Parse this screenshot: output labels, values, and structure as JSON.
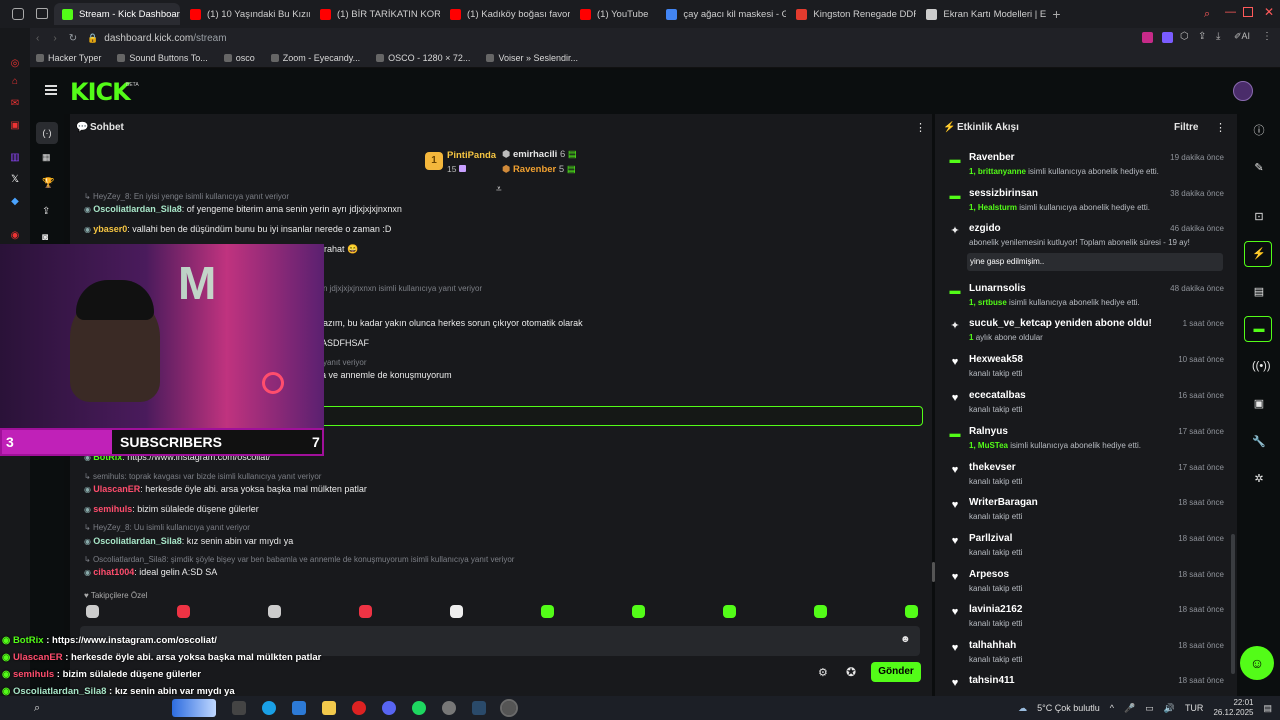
{
  "browser": {
    "tabs": [
      {
        "label": "Stream - Kick Dashboard",
        "color": "#53fc18",
        "active": true
      },
      {
        "label": "(1) 10 Yaşındaki Bu Kızın Ç",
        "color": "#ff0000"
      },
      {
        "label": "(1) BİR TARİKATIN KORKU",
        "color": "#ff0000"
      },
      {
        "label": "(1) Kadıköy boğası favori!",
        "color": "#ff0000"
      },
      {
        "label": "(1) YouTube",
        "color": "#ff0000"
      },
      {
        "label": "çay ağacı kil maskesi - Go",
        "color": "#4285f4"
      },
      {
        "label": "Kingston Renegade DDR5",
        "color": "#e33b2e"
      },
      {
        "label": "Ekran Kartı Modelleri | En",
        "color": "#cccccc"
      }
    ],
    "url_host": "dashboard.kick.com",
    "url_path": "/stream",
    "bookmarks": [
      "Hacker Typer",
      "Sound Buttons To...",
      "osco",
      "Zoom - Eyecandy...",
      "OSCO - 1280 × 72...",
      "Voiser » Seslendir..."
    ]
  },
  "kick": {
    "logo": "KICK",
    "beta": "BETA"
  },
  "chat": {
    "title": "Sohbet",
    "leaderboard": [
      {
        "rank": "1",
        "name": "PintiPanda",
        "count": "15"
      },
      {
        "name": "emirhacili",
        "count": "6"
      },
      {
        "name": "Ravenber",
        "count": "5"
      }
    ],
    "messages": [
      {
        "reply": "HeyZey_8: En iyisi yenge  isimli kullanıcıya yanıt veriyor"
      },
      {
        "user": "Oscoliatlardan_Sila8",
        "ucolor": "#a8e6c8",
        "text": "of yengeme biterim ama senin yerin ayrı jdjxjxjxjnxnxn"
      },
      {
        "user": "ybaser0",
        "ucolor": "#f5c542",
        "text": "vallahi ben de düşündüm bunu bu iyi insanlar nerede o zaman :D"
      },
      {
        "text": "m rahat 😄"
      },
      {
        "reply": "n jdjxjxjxjnxnxn isimli kullanıcıya yanıt veriyor"
      },
      {
        "text": "k lazım, bu kadar yakın olunca herkes sorun çıkıyor otomatik olarak"
      },
      {
        "text": "n ASDFHSAF"
      },
      {
        "reply": "yanıt veriyor"
      },
      {
        "text": "nla ve annemle de konuşmuyorum"
      },
      {
        "user": "BotRix",
        "ucolor": "#53fc18",
        "text": "https://www.instagram.com/oscoliat/"
      },
      {
        "reply": "semihuls: toprak kavgası var bizde isimli kullanıcıya yanıt veriyor"
      },
      {
        "user": "UlascanER",
        "ucolor": "#ff4d6d",
        "text": "herkesde öyle abi. arsa yoksa başka mal mülkten patlar"
      },
      {
        "user": "semihuls",
        "ucolor": "#ff4d6d",
        "text": "bizim sülalede düşene gülerler"
      },
      {
        "reply": "HeyZey_8: Uu isimli kullanıcıya yanıt veriyor"
      },
      {
        "user": "Oscoliatlardan_Sila8",
        "ucolor": "#a8e6c8",
        "text": "kız senin abin var mıydı ya"
      },
      {
        "reply": "Oscoliatlardan_Sila8: şimdik şöyle bişey var ben babamla ve annemle de konuşmuyorum isimli kullanıcıya yanıt veriyor"
      },
      {
        "user": "cihat1004",
        "ucolor": "#ff4d6d",
        "text": "ideal gelin A:SD SA"
      }
    ],
    "followers_label": "Takipçilere Özel",
    "send_label": "Gönder"
  },
  "webcam": {
    "label": "SUBSCRIBERS",
    "left": "3",
    "right": "7"
  },
  "overlay_chat": [
    {
      "user": "BotRix",
      "ucolor": "#53fc18",
      "text": "https://www.instagram.com/oscoliat/"
    },
    {
      "user": "UlascanER",
      "ucolor": "#ff4d6d",
      "text": "herkesde öyle abi. arsa yoksa başka mal mülkten patlar"
    },
    {
      "user": "semihuls",
      "ucolor": "#ff4d6d",
      "text": "bizim sülalede düşene gülerler"
    },
    {
      "user": "Oscoliatlardan_Sila8",
      "ucolor": "#a8e6c8",
      "text": "kız senin abin var mıydı ya"
    },
    {
      "user": "cihat1004",
      "ucolor": "#ff4d6d",
      "text": "ideal gelin A:SD SA"
    }
  ],
  "activity": {
    "title": "Etkinlik Akışı",
    "filter": "Filtre",
    "items": [
      {
        "name": "Ravenber",
        "time": "19 dakika önce",
        "count": "1,",
        "who": "brittanyanne",
        "rest": "isimli kullanıcıya abonelik hediye etti.",
        "icon": "gift-icon"
      },
      {
        "name": "sessizbirinsan",
        "time": "38 dakika önce",
        "count": "1,",
        "who": "Healsturm",
        "rest": "isimli kullanıcıya abonelik hediye etti.",
        "icon": "gift-icon"
      },
      {
        "name": "ezgido",
        "time": "46 dakika önce",
        "text": "abonelik yenilemesini kutluyor! Toplam abonelik süresi - 19 ay!",
        "quote": "yine gasp edilmişim..",
        "icon": "star-icon"
      },
      {
        "name": "Lunarnsolis",
        "time": "48 dakika önce",
        "count": "1,",
        "who": "srtbuse",
        "rest": "isimli kullanıcıya abonelik hediye etti.",
        "icon": "gift-icon"
      },
      {
        "name": "sucuk_ve_ketcap yeniden abone oldu!",
        "time": "1 saat önce",
        "count": "1",
        "rest": "aylık abone oldular",
        "icon": "star-icon"
      },
      {
        "name": "Hexweak58",
        "time": "10 saat önce",
        "text": "kanalı takip etti",
        "icon": "heart-icon"
      },
      {
        "name": "ececatalbas",
        "time": "16 saat önce",
        "text": "kanalı takip etti",
        "icon": "heart-icon"
      },
      {
        "name": "Ralnyus",
        "time": "17 saat önce",
        "count": "1,",
        "who": "MuSTea",
        "rest": "isimli kullanıcıya abonelik hediye etti.",
        "icon": "gift-icon"
      },
      {
        "name": "thekevser",
        "time": "17 saat önce",
        "text": "kanalı takip etti",
        "icon": "heart-icon"
      },
      {
        "name": "WriterBaragan",
        "time": "18 saat önce",
        "text": "kanalı takip etti",
        "icon": "heart-icon"
      },
      {
        "name": "Parllzival",
        "time": "18 saat önce",
        "text": "kanalı takip etti",
        "icon": "heart-icon"
      },
      {
        "name": "Arpesos",
        "time": "18 saat önce",
        "text": "kanalı takip etti",
        "icon": "heart-icon"
      },
      {
        "name": "lavinia2162",
        "time": "18 saat önce",
        "text": "kanalı takip etti",
        "icon": "heart-icon"
      },
      {
        "name": "talhahhah",
        "time": "18 saat önce",
        "text": "kanalı takip etti",
        "icon": "heart-icon"
      },
      {
        "name": "tahsin411",
        "time": "18 saat önce",
        "text": "",
        "icon": "heart-icon"
      }
    ]
  },
  "taskbar": {
    "weather": "5°C Çok bulutlu",
    "lang": "TUR",
    "time": "22:01",
    "date": "26.12.2025"
  }
}
